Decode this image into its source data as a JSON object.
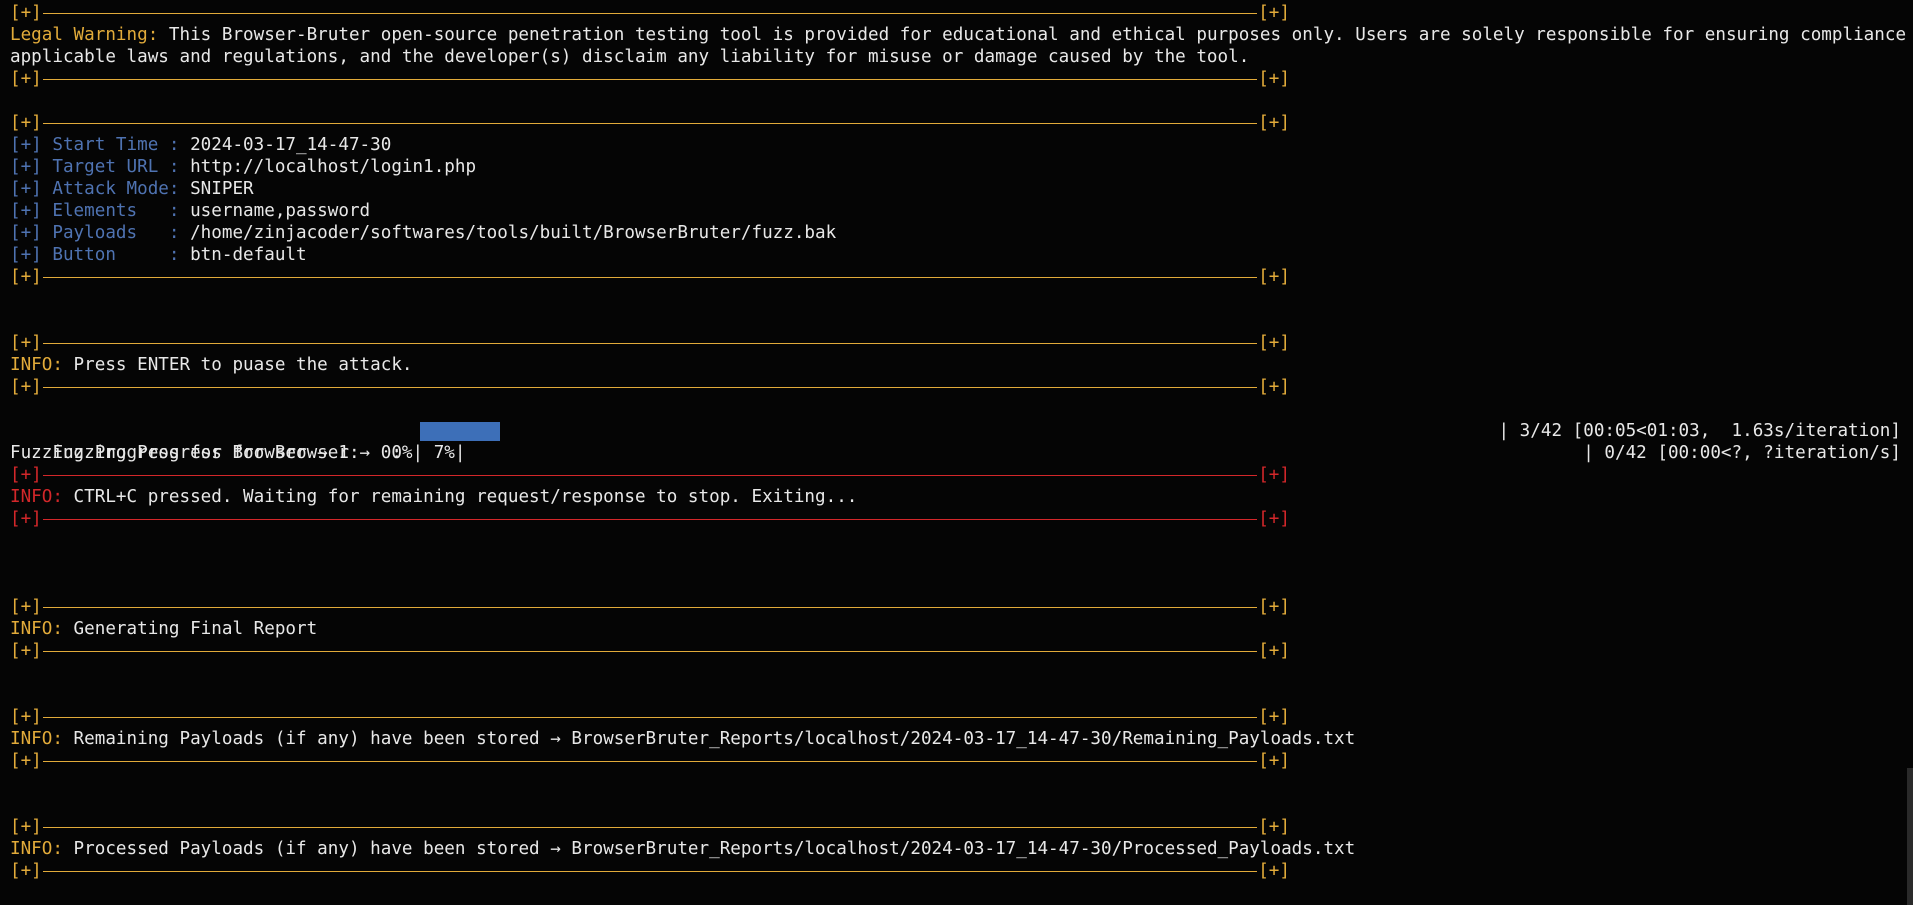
{
  "banner_bracket": "[+]",
  "legal": {
    "label": "Legal Warning:",
    "text_line1": " This Browser-Bruter open-source penetration testing tool is provided for educational and ethical purposes only. Users are solely responsible for ensuring compliance with all",
    "text_line2": "applicable laws and regulations, and the developer(s) disclaim any liability for misuse or damage caused by the tool."
  },
  "config": [
    {
      "prefix": "[+]",
      "key": " Start Time :",
      "value": " 2024-03-17_14-47-30"
    },
    {
      "prefix": "[+]",
      "key": " Target URL :",
      "value": " http://localhost/login1.php"
    },
    {
      "prefix": "[+]",
      "key": " Attack Mode:",
      "value": " SNIPER"
    },
    {
      "prefix": "[+]",
      "key": " Elements   :",
      "value": " username,password"
    },
    {
      "prefix": "[+]",
      "key": " Payloads   :",
      "value": " /home/zinjacoder/softwares/tools/built/BrowserBruter/fuzz.bak"
    },
    {
      "prefix": "[+]",
      "key": " Button     :",
      "value": " btn-default"
    }
  ],
  "info_label": "INFO:",
  "messages": {
    "pause": " Press ENTER to puase the attack.",
    "ctrlc": " CTRL+C pressed. Waiting for remaining request/response to stop. Exiting...",
    "report": " Generating Final Report",
    "remaining": " Remaining Payloads (if any) have been stored → BrowserBruter_Reports/localhost/2024-03-17_14-47-30/Remaining_Payloads.txt",
    "processed": " Processed Payloads (if any) have been stored → BrowserBruter_Reports/localhost/2024-03-17_14-47-30/Processed_Payloads.txt"
  },
  "progress": [
    {
      "label": "Fuzzing Progress for Browser → 0:   7%|",
      "percent": 7,
      "stats": "| 3/42 [00:05<01:03,  1.63s/iteration]"
    },
    {
      "label": "Fuzzing Progress for Browser → 1:   0%|",
      "percent": 0,
      "stats": "| 0/42 [00:00<?, ?iteration/s]"
    }
  ],
  "colors": {
    "background": "#050505",
    "accent_yellow": "#e2ab3a",
    "accent_blue": "#4f73b2",
    "accent_red": "#d3272a",
    "progress_fill": "#3d6fb8"
  }
}
